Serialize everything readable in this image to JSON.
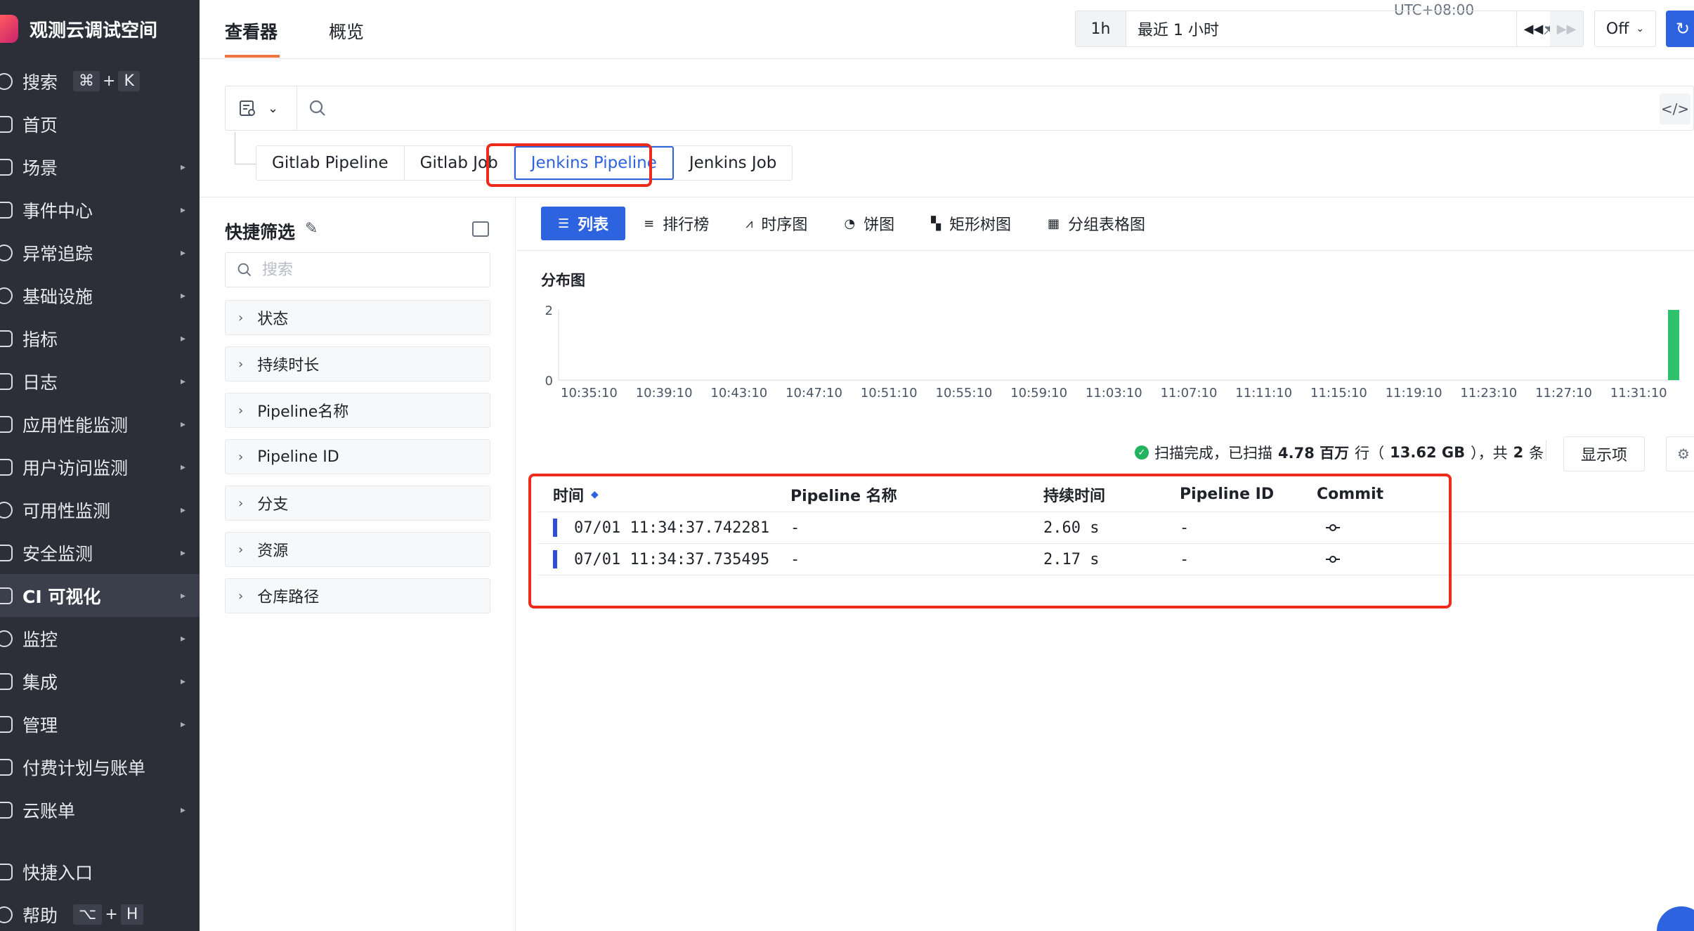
{
  "sidebar": {
    "brand": "观测云调试空间",
    "search_label": "搜索",
    "search_shortcut": [
      "⌘",
      "+",
      "K"
    ],
    "items": [
      {
        "label": "首页",
        "has_children": false
      },
      {
        "label": "场景",
        "has_children": true
      },
      {
        "label": "事件中心",
        "has_children": true
      },
      {
        "label": "异常追踪",
        "has_children": true
      },
      {
        "label": "基础设施",
        "has_children": true
      },
      {
        "label": "指标",
        "has_children": true
      },
      {
        "label": "日志",
        "has_children": true
      },
      {
        "label": "应用性能监测",
        "has_children": true
      },
      {
        "label": "用户访问监测",
        "has_children": true
      },
      {
        "label": "可用性监测",
        "has_children": true
      },
      {
        "label": "安全监测",
        "has_children": true
      },
      {
        "label": "CI 可视化",
        "has_children": true,
        "active": true
      },
      {
        "label": "监控",
        "has_children": true
      },
      {
        "label": "集成",
        "has_children": true
      },
      {
        "label": "管理",
        "has_children": true
      },
      {
        "label": "付费计划与账单",
        "has_children": false
      },
      {
        "label": "云账单",
        "has_children": true
      }
    ],
    "bottom": {
      "shortcut_label": "快捷入口",
      "help_label": "帮助",
      "help_shortcut": [
        "⌥",
        "+",
        "H"
      ]
    }
  },
  "topbar": {
    "tabs": [
      "查看器",
      "概览"
    ],
    "active_tab": "查看器",
    "timezone": "UTC+08:00",
    "time_quick": "1h",
    "time_label": "最近 1 小时",
    "refresh_mode": "Off"
  },
  "search": {
    "placeholder": "",
    "source_tabs": [
      "Gitlab Pipeline",
      "Gitlab Job",
      "Jenkins Pipeline",
      "Jenkins Job"
    ],
    "active_source": "Jenkins Pipeline"
  },
  "quick_filter": {
    "title": "快捷筛选",
    "search_placeholder": "搜索",
    "facets": [
      "状态",
      "持续时长",
      "Pipeline名称",
      "Pipeline ID",
      "分支",
      "资源",
      "仓库路径"
    ]
  },
  "views": {
    "tabs": [
      "列表",
      "排行榜",
      "时序图",
      "饼图",
      "矩形树图",
      "分组表格图"
    ],
    "active": "列表"
  },
  "distribution": {
    "title": "分布图"
  },
  "chart_data": {
    "type": "bar",
    "title": "",
    "xlabel": "",
    "ylabel": "",
    "ylim": [
      0,
      2
    ],
    "y_ticks": [
      "2",
      "0"
    ],
    "x_tick_labels": [
      "10:35:10",
      "10:39:10",
      "10:43:10",
      "10:47:10",
      "10:51:10",
      "10:55:10",
      "10:59:10",
      "11:03:10",
      "11:07:10",
      "11:11:10",
      "11:15:10",
      "11:19:10",
      "11:23:10",
      "11:27:10",
      "11:31:10"
    ],
    "bars": [
      {
        "x": "11:34",
        "value": 2
      }
    ],
    "bar_color": "#2fc16c"
  },
  "scan": {
    "prefix": "扫描完成，已扫描",
    "rows_value": "4.78 百万",
    "rows_unit": "行（",
    "size": "13.62 GB",
    "suffix_1": "），共",
    "count": "2",
    "suffix_2": "条",
    "display_button": "显示项"
  },
  "table": {
    "columns": [
      "时间",
      "Pipeline 名称",
      "持续时间",
      "Pipeline ID",
      "Commit"
    ],
    "rows": [
      {
        "time": "07/01 11:34:37.742281",
        "name": "-",
        "duration": "2.60 s",
        "id": "-",
        "commit": "commit-icon"
      },
      {
        "time": "07/01 11:34:37.735495",
        "name": "-",
        "duration": "2.17 s",
        "id": "-",
        "commit": "commit-icon"
      }
    ]
  },
  "colors": {
    "accent": "#2e63e0",
    "highlight_box": "#ee2a1c",
    "sidebar_bg": "#2c2f38",
    "tab_underline": "#f07444"
  }
}
